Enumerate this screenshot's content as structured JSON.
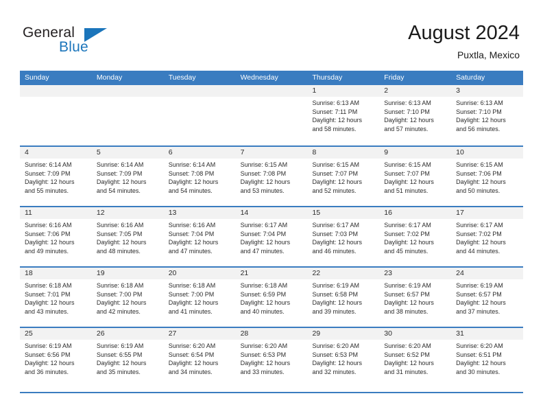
{
  "brand": {
    "name_part1": "General",
    "name_part2": "Blue",
    "logo_icon": "triangle-flag-icon"
  },
  "header": {
    "title": "August 2024",
    "subtitle": "Puxtla, Mexico"
  },
  "colors": {
    "header_blue": "#3a7cc0",
    "brand_blue": "#1b75bb",
    "day_header_gray": "#f2f2f2",
    "text": "#2b2b2b"
  },
  "weekdays": [
    "Sunday",
    "Monday",
    "Tuesday",
    "Wednesday",
    "Thursday",
    "Friday",
    "Saturday"
  ],
  "weeks": [
    [
      {
        "date": "",
        "empty": true
      },
      {
        "date": "",
        "empty": true
      },
      {
        "date": "",
        "empty": true
      },
      {
        "date": "",
        "empty": true
      },
      {
        "date": "1",
        "sunrise": "Sunrise: 6:13 AM",
        "sunset": "Sunset: 7:11 PM",
        "daylight1": "Daylight: 12 hours",
        "daylight2": "and 58 minutes."
      },
      {
        "date": "2",
        "sunrise": "Sunrise: 6:13 AM",
        "sunset": "Sunset: 7:10 PM",
        "daylight1": "Daylight: 12 hours",
        "daylight2": "and 57 minutes."
      },
      {
        "date": "3",
        "sunrise": "Sunrise: 6:13 AM",
        "sunset": "Sunset: 7:10 PM",
        "daylight1": "Daylight: 12 hours",
        "daylight2": "and 56 minutes."
      }
    ],
    [
      {
        "date": "4",
        "sunrise": "Sunrise: 6:14 AM",
        "sunset": "Sunset: 7:09 PM",
        "daylight1": "Daylight: 12 hours",
        "daylight2": "and 55 minutes."
      },
      {
        "date": "5",
        "sunrise": "Sunrise: 6:14 AM",
        "sunset": "Sunset: 7:09 PM",
        "daylight1": "Daylight: 12 hours",
        "daylight2": "and 54 minutes."
      },
      {
        "date": "6",
        "sunrise": "Sunrise: 6:14 AM",
        "sunset": "Sunset: 7:08 PM",
        "daylight1": "Daylight: 12 hours",
        "daylight2": "and 54 minutes."
      },
      {
        "date": "7",
        "sunrise": "Sunrise: 6:15 AM",
        "sunset": "Sunset: 7:08 PM",
        "daylight1": "Daylight: 12 hours",
        "daylight2": "and 53 minutes."
      },
      {
        "date": "8",
        "sunrise": "Sunrise: 6:15 AM",
        "sunset": "Sunset: 7:07 PM",
        "daylight1": "Daylight: 12 hours",
        "daylight2": "and 52 minutes."
      },
      {
        "date": "9",
        "sunrise": "Sunrise: 6:15 AM",
        "sunset": "Sunset: 7:07 PM",
        "daylight1": "Daylight: 12 hours",
        "daylight2": "and 51 minutes."
      },
      {
        "date": "10",
        "sunrise": "Sunrise: 6:15 AM",
        "sunset": "Sunset: 7:06 PM",
        "daylight1": "Daylight: 12 hours",
        "daylight2": "and 50 minutes."
      }
    ],
    [
      {
        "date": "11",
        "sunrise": "Sunrise: 6:16 AM",
        "sunset": "Sunset: 7:06 PM",
        "daylight1": "Daylight: 12 hours",
        "daylight2": "and 49 minutes."
      },
      {
        "date": "12",
        "sunrise": "Sunrise: 6:16 AM",
        "sunset": "Sunset: 7:05 PM",
        "daylight1": "Daylight: 12 hours",
        "daylight2": "and 48 minutes."
      },
      {
        "date": "13",
        "sunrise": "Sunrise: 6:16 AM",
        "sunset": "Sunset: 7:04 PM",
        "daylight1": "Daylight: 12 hours",
        "daylight2": "and 47 minutes."
      },
      {
        "date": "14",
        "sunrise": "Sunrise: 6:17 AM",
        "sunset": "Sunset: 7:04 PM",
        "daylight1": "Daylight: 12 hours",
        "daylight2": "and 47 minutes."
      },
      {
        "date": "15",
        "sunrise": "Sunrise: 6:17 AM",
        "sunset": "Sunset: 7:03 PM",
        "daylight1": "Daylight: 12 hours",
        "daylight2": "and 46 minutes."
      },
      {
        "date": "16",
        "sunrise": "Sunrise: 6:17 AM",
        "sunset": "Sunset: 7:02 PM",
        "daylight1": "Daylight: 12 hours",
        "daylight2": "and 45 minutes."
      },
      {
        "date": "17",
        "sunrise": "Sunrise: 6:17 AM",
        "sunset": "Sunset: 7:02 PM",
        "daylight1": "Daylight: 12 hours",
        "daylight2": "and 44 minutes."
      }
    ],
    [
      {
        "date": "18",
        "sunrise": "Sunrise: 6:18 AM",
        "sunset": "Sunset: 7:01 PM",
        "daylight1": "Daylight: 12 hours",
        "daylight2": "and 43 minutes."
      },
      {
        "date": "19",
        "sunrise": "Sunrise: 6:18 AM",
        "sunset": "Sunset: 7:00 PM",
        "daylight1": "Daylight: 12 hours",
        "daylight2": "and 42 minutes."
      },
      {
        "date": "20",
        "sunrise": "Sunrise: 6:18 AM",
        "sunset": "Sunset: 7:00 PM",
        "daylight1": "Daylight: 12 hours",
        "daylight2": "and 41 minutes."
      },
      {
        "date": "21",
        "sunrise": "Sunrise: 6:18 AM",
        "sunset": "Sunset: 6:59 PM",
        "daylight1": "Daylight: 12 hours",
        "daylight2": "and 40 minutes."
      },
      {
        "date": "22",
        "sunrise": "Sunrise: 6:19 AM",
        "sunset": "Sunset: 6:58 PM",
        "daylight1": "Daylight: 12 hours",
        "daylight2": "and 39 minutes."
      },
      {
        "date": "23",
        "sunrise": "Sunrise: 6:19 AM",
        "sunset": "Sunset: 6:57 PM",
        "daylight1": "Daylight: 12 hours",
        "daylight2": "and 38 minutes."
      },
      {
        "date": "24",
        "sunrise": "Sunrise: 6:19 AM",
        "sunset": "Sunset: 6:57 PM",
        "daylight1": "Daylight: 12 hours",
        "daylight2": "and 37 minutes."
      }
    ],
    [
      {
        "date": "25",
        "sunrise": "Sunrise: 6:19 AM",
        "sunset": "Sunset: 6:56 PM",
        "daylight1": "Daylight: 12 hours",
        "daylight2": "and 36 minutes."
      },
      {
        "date": "26",
        "sunrise": "Sunrise: 6:19 AM",
        "sunset": "Sunset: 6:55 PM",
        "daylight1": "Daylight: 12 hours",
        "daylight2": "and 35 minutes."
      },
      {
        "date": "27",
        "sunrise": "Sunrise: 6:20 AM",
        "sunset": "Sunset: 6:54 PM",
        "daylight1": "Daylight: 12 hours",
        "daylight2": "and 34 minutes."
      },
      {
        "date": "28",
        "sunrise": "Sunrise: 6:20 AM",
        "sunset": "Sunset: 6:53 PM",
        "daylight1": "Daylight: 12 hours",
        "daylight2": "and 33 minutes."
      },
      {
        "date": "29",
        "sunrise": "Sunrise: 6:20 AM",
        "sunset": "Sunset: 6:53 PM",
        "daylight1": "Daylight: 12 hours",
        "daylight2": "and 32 minutes."
      },
      {
        "date": "30",
        "sunrise": "Sunrise: 6:20 AM",
        "sunset": "Sunset: 6:52 PM",
        "daylight1": "Daylight: 12 hours",
        "daylight2": "and 31 minutes."
      },
      {
        "date": "31",
        "sunrise": "Sunrise: 6:20 AM",
        "sunset": "Sunset: 6:51 PM",
        "daylight1": "Daylight: 12 hours",
        "daylight2": "and 30 minutes."
      }
    ]
  ]
}
